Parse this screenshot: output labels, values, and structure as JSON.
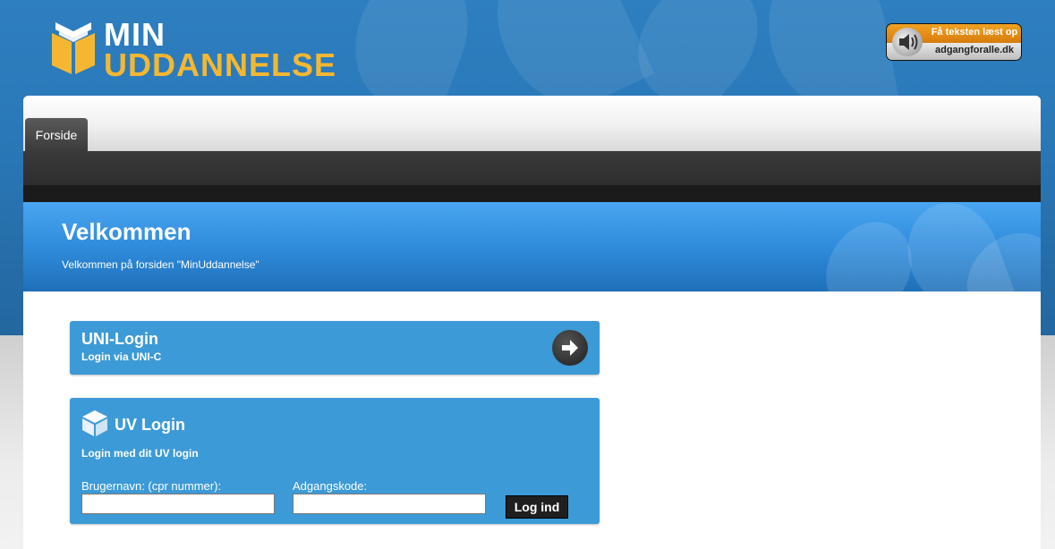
{
  "header": {
    "logo_line1": "MIN",
    "logo_line2": "UDDANNELSE",
    "tts_line1": "Få teksten læst op",
    "tts_line2": "adgangforalle.dk"
  },
  "nav": {
    "tabs": [
      {
        "label": "Forside"
      }
    ]
  },
  "hero": {
    "title": "Velkommen",
    "subtitle": "Velkommen på forsiden \"MinUddannelse\""
  },
  "uni_login": {
    "title": "UNI-Login",
    "subtitle": "Login via UNI-C"
  },
  "uv_login": {
    "title": "UV Login",
    "subtitle": "Login med dit UV login",
    "username_label": "Brugernavn: (cpr nummer):",
    "username_value": "",
    "password_label": "Adgangskode:",
    "password_value": "",
    "submit_label": "Log ind"
  },
  "colors": {
    "header_blue": "#2e7fc0",
    "logo_yellow": "#f5b731",
    "box_blue": "#3c9ad6",
    "nav_dark": "#2e2e2e"
  },
  "icons": {
    "logo": "book-icon",
    "tts": "speaker-icon",
    "uni_arrow": "arrow-right-icon",
    "uv": "cube-icon"
  }
}
